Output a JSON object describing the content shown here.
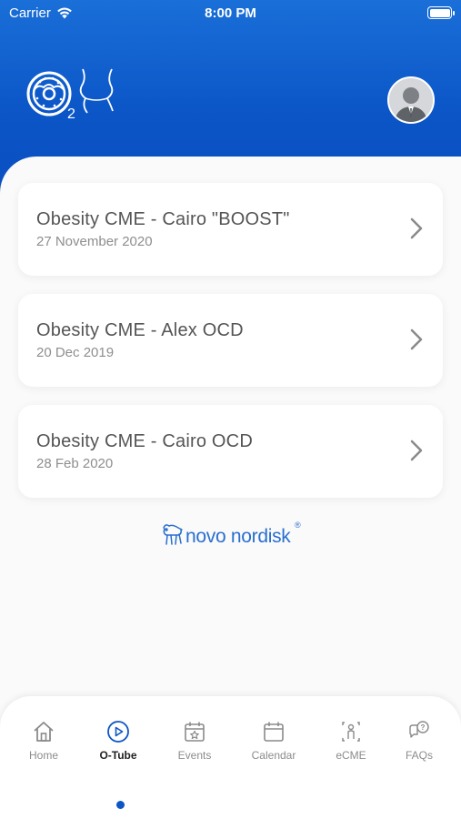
{
  "status_bar": {
    "carrier": "Carrier",
    "time": "8:00 PM"
  },
  "header": {
    "logo_icon": "o2-donut-logo-icon",
    "avatar_icon": "user-avatar-icon"
  },
  "events": [
    {
      "title": "Obesity CME - Cairo \"BOOST\"",
      "date": "27 November 2020"
    },
    {
      "title": "Obesity CME - Alex OCD",
      "date": "20 Dec 2019"
    },
    {
      "title": "Obesity CME - Cairo OCD",
      "date": "28 Feb 2020"
    }
  ],
  "brand": {
    "name": "novo nordisk",
    "mark": "®"
  },
  "tabs": [
    {
      "label": "Home",
      "icon": "home-icon"
    },
    {
      "label": "O-Tube",
      "icon": "play-circle-icon",
      "active": true
    },
    {
      "label": "Events",
      "icon": "calendar-star-icon"
    },
    {
      "label": "Calendar",
      "icon": "calendar-icon"
    },
    {
      "label": "eCME",
      "icon": "person-scan-icon"
    },
    {
      "label": "FAQs",
      "icon": "chat-question-icon"
    }
  ],
  "colors": {
    "primary": "#0b55c7",
    "card_title": "#555555",
    "card_date": "#8e8e8e",
    "brand": "#2a6fcf"
  }
}
